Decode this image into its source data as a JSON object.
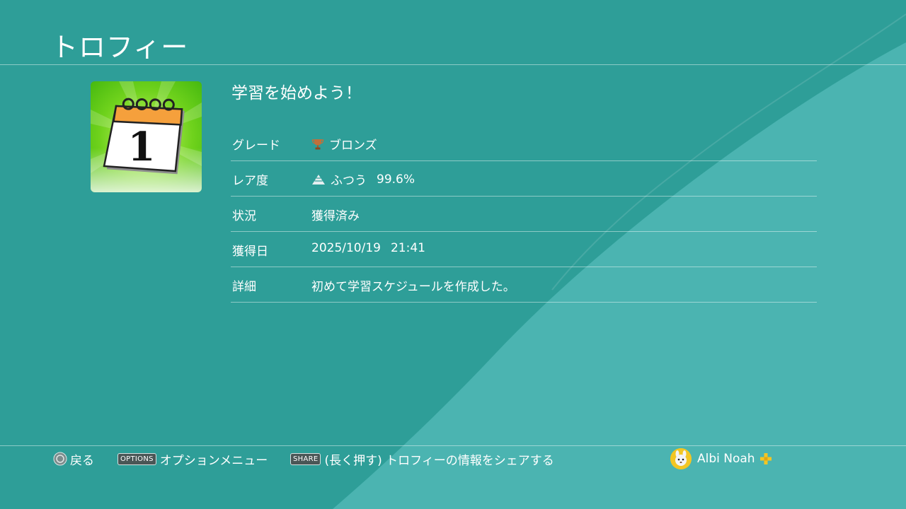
{
  "header": {
    "title": "トロフィー"
  },
  "trophy": {
    "icon": "calendar-icon",
    "icon_text": "1",
    "name": "学習を始めよう！",
    "details": [
      {
        "label": "グレード",
        "value": "ブロンズ",
        "icon": "bronze-trophy-icon"
      },
      {
        "label": "レア度",
        "value": "ふつう",
        "extra": "99.6%",
        "icon": "rarity-pyramid-icon"
      },
      {
        "label": "状況",
        "value": "獲得済み"
      },
      {
        "label": "獲得日",
        "value": "2025/10/19",
        "extra": "21:41"
      },
      {
        "label": "詳細",
        "value": "初めて学習スケジュールを作成した。"
      }
    ]
  },
  "footer": {
    "back": {
      "button": "circle-button-icon",
      "label": "戻る"
    },
    "options": {
      "key": "OPTIONS",
      "label": "オプションメニュー"
    },
    "share": {
      "key": "SHARE",
      "label": "(長く押す) トロフィーの情報をシェアする"
    },
    "user": {
      "name": "Albi Noah",
      "plus_icon": "playstation-plus-icon"
    }
  },
  "colors": {
    "background": "#2e9e98",
    "wave": "#4db5b2",
    "bronze": "#c0703a",
    "accent_plus": "#f3c623"
  }
}
